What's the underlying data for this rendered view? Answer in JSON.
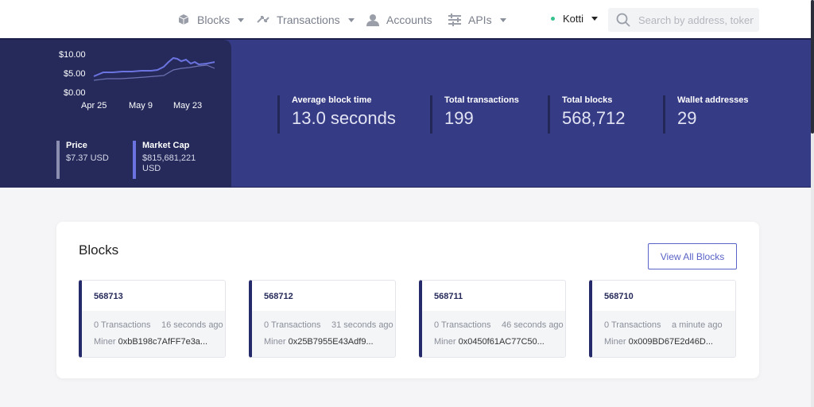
{
  "nav": {
    "items": [
      {
        "label": "Blocks",
        "icon": "cube-icon",
        "dropdown": true
      },
      {
        "label": "Transactions",
        "icon": "arrows-exchange-icon",
        "dropdown": true
      },
      {
        "label": "Accounts",
        "icon": "user-icon",
        "dropdown": false
      },
      {
        "label": "APIs",
        "icon": "sliders-icon",
        "dropdown": true
      }
    ],
    "network": "Kotti",
    "search_placeholder": "Search by address, token symbol name, transaction hash, or block number"
  },
  "price_chart": {
    "y_ticks": [
      "$10.00",
      "$5.00",
      "$0.00"
    ],
    "x_ticks": [
      "Apr 25",
      "May 9",
      "May 23"
    ]
  },
  "mini_stats": {
    "price_label": "Price",
    "price_value": "$7.37 USD",
    "market_cap_label": "Market Cap",
    "market_cap_value_1": "$815,681,221",
    "market_cap_value_2": "USD"
  },
  "stats": [
    {
      "label": "Average block time",
      "value": "13.0 seconds"
    },
    {
      "label": "Total transactions",
      "value": "199"
    },
    {
      "label": "Total blocks",
      "value": "568,712"
    },
    {
      "label": "Wallet addresses",
      "value": "29"
    }
  ],
  "blocks_card": {
    "title": "Blocks",
    "view_all": "View All Blocks",
    "miner_label": "Miner",
    "blocks": [
      {
        "number": "568713",
        "transactions": "0 Transactions",
        "age": "16 seconds ago",
        "miner": "0xbB198c7AfFF7e3a..."
      },
      {
        "number": "568712",
        "transactions": "0 Transactions",
        "age": "31 seconds ago",
        "miner": "0x25B7955E43Adf9..."
      },
      {
        "number": "568711",
        "transactions": "0 Transactions",
        "age": "46 seconds ago",
        "miner": "0x0450f61AC77C50..."
      },
      {
        "number": "568710",
        "transactions": "0 Transactions",
        "age": "a minute ago",
        "miner": "0x009BD67E2d46D..."
      }
    ]
  },
  "colors": {
    "nav_dark": "#1c1f4a",
    "band": "#363b85",
    "left_panel": "#252a5a",
    "accent": "#5a63c7",
    "status_green": "#36c28f"
  }
}
